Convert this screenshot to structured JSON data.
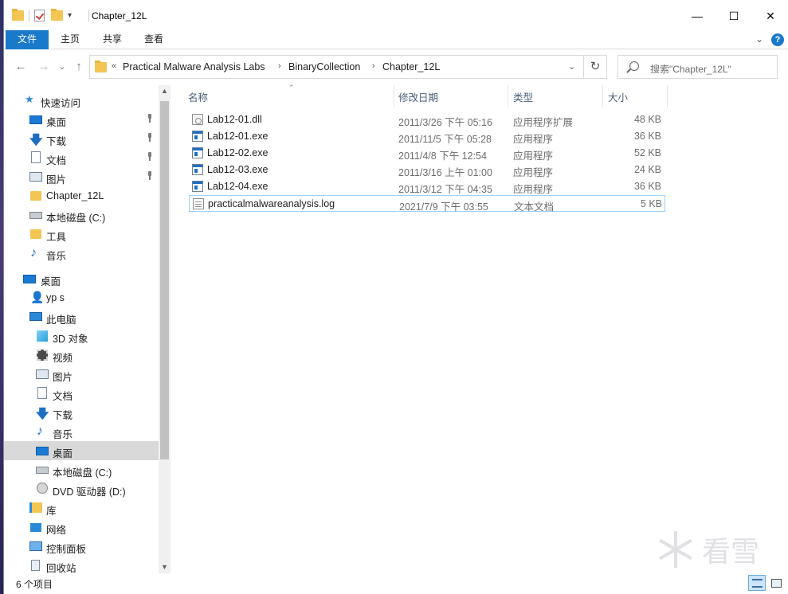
{
  "window": {
    "title": "Chapter_12L",
    "controls": {
      "minimize": "—",
      "maximize": "☐",
      "close": "✕"
    }
  },
  "ribbon": {
    "tabs": [
      "文件",
      "主页",
      "共享",
      "查看"
    ],
    "expand": "⌄",
    "help": "?"
  },
  "address": {
    "back": "←",
    "forward": "→",
    "recent": "⌄",
    "up": "↑",
    "overflow": "«",
    "segments": [
      "Practical Malware Analysis Labs",
      "BinaryCollection",
      "Chapter_12L"
    ],
    "sep": "›",
    "dropdown": "⌄",
    "refresh": "↻"
  },
  "search": {
    "placeholder": "搜索\"Chapter_12L\""
  },
  "nav": {
    "quick_access": "快速访问",
    "items": [
      {
        "label": "桌面",
        "pinned": true
      },
      {
        "label": "下载",
        "pinned": true
      },
      {
        "label": "文档",
        "pinned": true
      },
      {
        "label": "图片",
        "pinned": true
      },
      {
        "label": "Chapter_12L",
        "pinned": false
      },
      {
        "label": "本地磁盘 (C:)",
        "pinned": false
      },
      {
        "label": "工具",
        "pinned": false
      },
      {
        "label": "音乐",
        "pinned": false
      }
    ],
    "desktop": "桌面",
    "user": "yp s",
    "this_pc": "此电脑",
    "pc_items": [
      "3D 对象",
      "视频",
      "图片",
      "文档",
      "下载",
      "音乐",
      "桌面",
      "本地磁盘 (C:)",
      "DVD 驱动器 (D:)"
    ],
    "libraries": "库",
    "network": "网络",
    "control_panel": "控制面板",
    "recycle_bin": "回收站"
  },
  "columns": {
    "name": "名称",
    "date": "修改日期",
    "type": "类型",
    "size": "大小"
  },
  "files": [
    {
      "name": "Lab12-01.dll",
      "date": "2011/3/26 下午 05:16",
      "type": "应用程序扩展",
      "size": "48 KB",
      "icon": "dll-icon"
    },
    {
      "name": "Lab12-01.exe",
      "date": "2011/11/5 下午 05:28",
      "type": "应用程序",
      "size": "36 KB",
      "icon": "exe-icon"
    },
    {
      "name": "Lab12-02.exe",
      "date": "2011/4/8 下午 12:54",
      "type": "应用程序",
      "size": "52 KB",
      "icon": "exe-icon"
    },
    {
      "name": "Lab12-03.exe",
      "date": "2011/3/16 上午 01:00",
      "type": "应用程序",
      "size": "24 KB",
      "icon": "exe-icon"
    },
    {
      "name": "Lab12-04.exe",
      "date": "2011/3/12 下午 04:35",
      "type": "应用程序",
      "size": "36 KB",
      "icon": "exe-icon"
    },
    {
      "name": "practicalmalwareanalysis.log",
      "date": "2021/7/9 下午 03:55",
      "type": "文本文档",
      "size": "5 KB",
      "icon": "text-file-icon"
    }
  ],
  "status": {
    "count": "6 个项目"
  },
  "watermark": "看雪",
  "colors": {
    "accent": "#1979ca",
    "selection": "#99d1ff"
  }
}
